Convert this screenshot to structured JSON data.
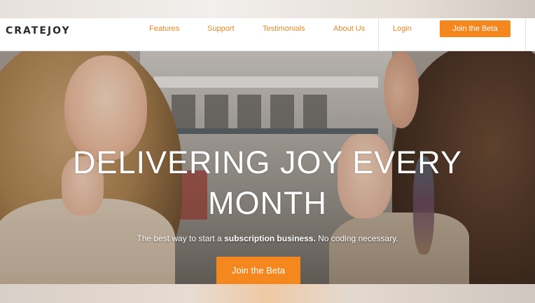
{
  "brand": {
    "logo": "CRATEJOY"
  },
  "nav": {
    "links": [
      "Features",
      "Support",
      "Testimonials",
      "About Us"
    ],
    "login": "Login",
    "cta": "Join the Beta"
  },
  "hero": {
    "headline_line1": "DELIVERING JOY EVERY",
    "headline_line2": "MONTH",
    "tagline_pre": "The best way to start a ",
    "tagline_bold": "subscription business.",
    "tagline_post": " No coding necessary.",
    "cta": "Join the Beta"
  },
  "colors": {
    "accent": "#f5871f",
    "nav_link": "#e8892a"
  }
}
